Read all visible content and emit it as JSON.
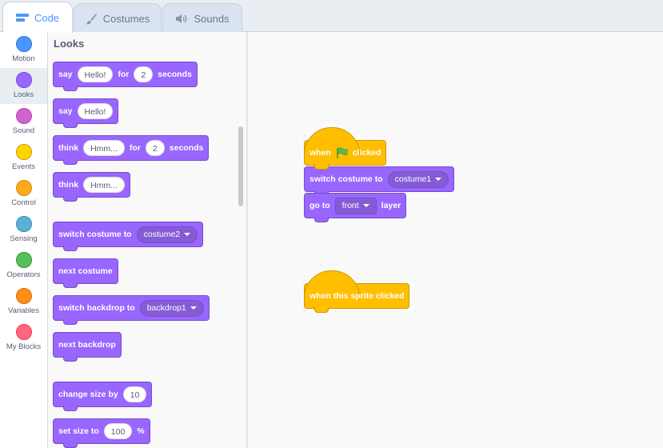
{
  "tabs": [
    {
      "label": "Code",
      "icon": "code-icon",
      "active": true
    },
    {
      "label": "Costumes",
      "icon": "paintbrush-icon"
    },
    {
      "label": "Sounds",
      "icon": "speaker-icon"
    }
  ],
  "categories": [
    {
      "label": "Motion",
      "color": "#4c97ff"
    },
    {
      "label": "Looks",
      "color": "#9966ff",
      "active": true
    },
    {
      "label": "Sound",
      "color": "#cf63cf"
    },
    {
      "label": "Events",
      "color": "#ffd500"
    },
    {
      "label": "Control",
      "color": "#ffab19"
    },
    {
      "label": "Sensing",
      "color": "#5cb1d6"
    },
    {
      "label": "Operators",
      "color": "#59c059"
    },
    {
      "label": "Variables",
      "color": "#ff8c1a"
    },
    {
      "label": "My Blocks",
      "color": "#ff6680"
    }
  ],
  "palette": {
    "title": "Looks",
    "say_for": {
      "say": "say",
      "msg": "Hello!",
      "for": "for",
      "secs": "2",
      "seconds": "seconds"
    },
    "say": {
      "say": "say",
      "msg": "Hello!"
    },
    "think_for": {
      "think": "think",
      "msg": "Hmm...",
      "for": "for",
      "secs": "2",
      "seconds": "seconds"
    },
    "think": {
      "think": "think",
      "msg": "Hmm..."
    },
    "switch_costume": {
      "label": "switch costume to",
      "value": "costume2"
    },
    "next_costume": "next costume",
    "switch_backdrop": {
      "label": "switch backdrop to",
      "value": "backdrop1"
    },
    "next_backdrop": "next backdrop",
    "change_size": {
      "label": "change size by",
      "value": "10"
    },
    "set_size": {
      "label": "set size to",
      "value": "100",
      "unit": "%"
    }
  },
  "workspace": {
    "script1": {
      "when": "when",
      "clicked": "clicked",
      "switch_costume": {
        "label": "switch costume to",
        "value": "costume1"
      },
      "go_to": {
        "go": "go to",
        "value": "front",
        "layer": "layer"
      }
    },
    "script2": {
      "label": "when this sprite clicked"
    }
  },
  "colors": {
    "looks": "#9966ff",
    "events": "#ffbf00",
    "accent": "#4c97ff",
    "flag": "#4cbf56"
  }
}
